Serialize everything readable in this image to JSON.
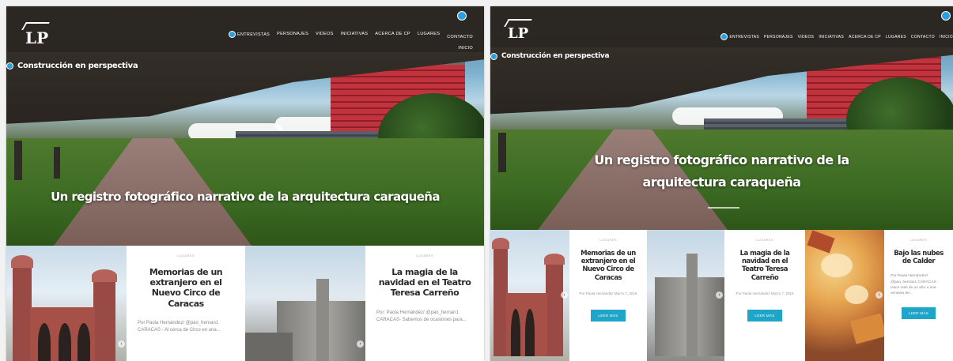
{
  "colors": {
    "accent": "#1fa5c8",
    "icon_blue": "#2aa0e0",
    "header_dark": "#2b2622"
  },
  "left": {
    "logo": "LP",
    "nav": [
      "Entrevistas",
      "Personajes",
      "Videos",
      "Iniciativas",
      "Acerca de CP",
      "Lugares",
      "Contacto",
      "Inicio"
    ],
    "site_tag": "Construcción en perspectiva",
    "tagline": "Un registro fotográfico narrativo de la arquitectura caraqueña",
    "cards": [
      {
        "category": "LUGARES",
        "title": "Memorias de un extranjero en el Nuevo Circo de Caracas",
        "excerpt": "Por Paola Hernández/ @pao_hernan1 CARACAS - Al cerca de Circo en una..."
      },
      {
        "category": "LUGARES",
        "title": "La magia de la navidad en el Teatro Teresa Carreño",
        "excerpt": "Por: Paola Hernández/ @pao_hernan1 CARACAS- Sabemos de ocasiones para..."
      }
    ]
  },
  "right": {
    "logo": "LP",
    "nav": [
      "Entrevistas",
      "Personajes",
      "Videos",
      "Iniciativas",
      "Acerca de CP",
      "Lugares",
      "Contacto",
      "Inicio"
    ],
    "site_tag": "Construcción en perspectiva",
    "tagline_line1": "Un registro fotográfico narrativo de la",
    "tagline_line2": "arquitectura caraqueña",
    "cards": [
      {
        "category": "LUGARES",
        "title": "Memorias de un extranjero en el Nuevo Circo de Caracas",
        "byline": "Por Paola Hernández Marzo 7, 2016",
        "button": "LEER MÁS"
      },
      {
        "category": "LUGARES",
        "title": "La magia de la navidad en el Teatro Teresa Carreño",
        "byline": "Por Paola Hernández Marzo 7, 2016",
        "button": "LEER MÁS"
      },
      {
        "category": "LUGARES",
        "title": "Bajo las nubes de Calder",
        "excerpt": "Por Paola Hernández/ @pao_hernan1 CARACAS - Hace más de un año a una ventana de...",
        "button": "LEER MÁS"
      }
    ]
  }
}
